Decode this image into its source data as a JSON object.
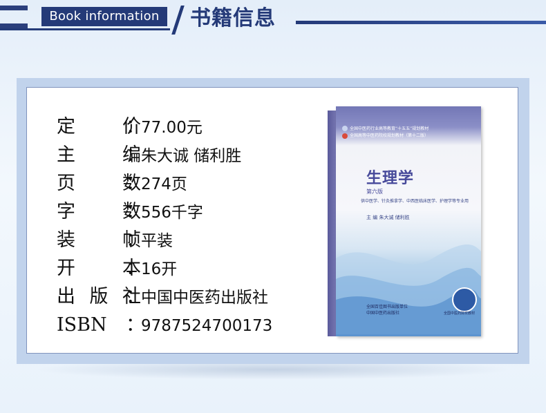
{
  "header": {
    "tag": "Book information",
    "title": "书籍信息"
  },
  "book_info": [
    {
      "label": "定 价",
      "value": "77.00元"
    },
    {
      "label": "主 编",
      "value": "朱大诚 储利胜"
    },
    {
      "label": "页 数",
      "value": "274页"
    },
    {
      "label": "字 数",
      "value": "556千字"
    },
    {
      "label": "装 帧",
      "value": "平装"
    },
    {
      "label": "开 本",
      "value": "16开"
    },
    {
      "label": "出版社",
      "value": "中国中医药出版社"
    },
    {
      "label": "ISBN",
      "value": "9787524700173"
    }
  ],
  "colon": "：",
  "cover": {
    "top_line1": "全国中医药行业高等教育“十五五”规划教材",
    "top_line2": "全国高等中医药院校规划教材（第十二版）",
    "title": "生理学",
    "edition": "第六版",
    "subtitle": "供中医学、针灸推拿学、中西医临床医学、护理学等专业用",
    "authors": "主 编  朱大诚    储利胜",
    "publisher1": "全国百佳图书出版单位",
    "publisher2": "中国中医药出版社",
    "seal_label": "全国中医药院校教材",
    "colors": {
      "purple": "#6d71b2",
      "title": "#46499a",
      "blue": "#5b93cf"
    }
  }
}
